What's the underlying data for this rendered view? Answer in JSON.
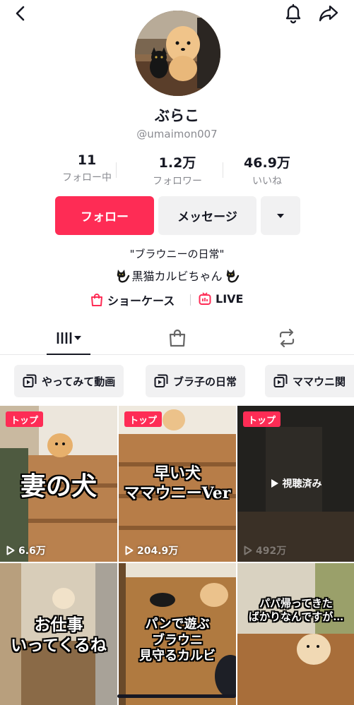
{
  "profile": {
    "name": "ぶらこ",
    "handle": "@umaimon007",
    "stats": [
      {
        "value": "11",
        "label": "フォロー中"
      },
      {
        "value": "1.2万",
        "label": "フォロワー"
      },
      {
        "value": "46.9万",
        "label": "いいね"
      }
    ],
    "bio_line1": "\"ブラウニーの日常\"",
    "bio_line2": "黒猫カルビちゃん"
  },
  "actions": {
    "follow_label": "フォロー",
    "message_label": "メッセージ"
  },
  "links": {
    "showcase": "ショーケース",
    "live": "LIVE"
  },
  "playlists": [
    {
      "label": "やってみて動画"
    },
    {
      "label": "ブラ子の日常"
    },
    {
      "label": "ママウニ関"
    }
  ],
  "videos": [
    {
      "badge": "トップ",
      "caption": "妻の犬",
      "views": "6.6万"
    },
    {
      "badge": "トップ",
      "caption": "早い犬\nママウニーVer",
      "views": "204.9万"
    },
    {
      "badge": "トップ",
      "caption": "",
      "watched": "視聴済み",
      "views": "492万"
    },
    {
      "caption": "お仕事\nいってくるね"
    },
    {
      "caption": "パンで遊ぶ\nブラウニ\n見守るカルビ"
    },
    {
      "caption": "パパ帰ってきた\nばかりなんですが…"
    }
  ],
  "colors": {
    "accent": "#fe2c55",
    "secondary_bg": "#f1f1f2",
    "muted_text": "#8a8b91"
  },
  "icons": [
    "back-icon",
    "bell-icon",
    "share-icon",
    "chevron-down-icon",
    "grid-icon",
    "shopping-bag-icon",
    "repost-icon",
    "playlist-icon",
    "play-icon",
    "black-cat-icon",
    "live-icon"
  ]
}
